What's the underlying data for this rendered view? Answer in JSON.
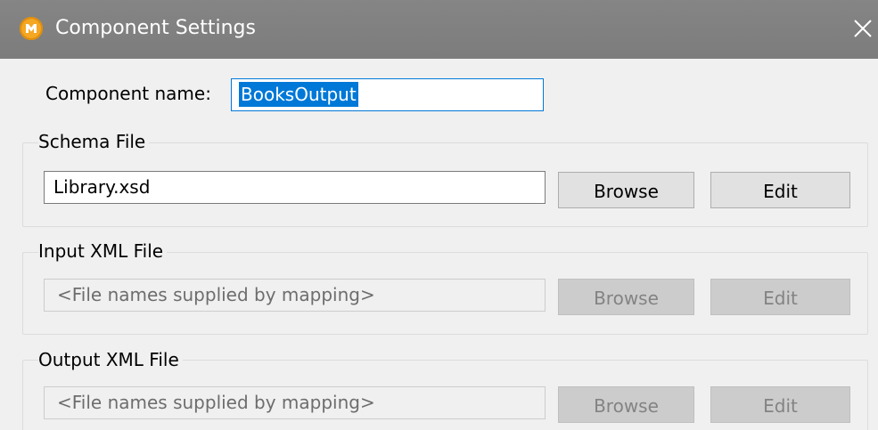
{
  "window": {
    "title": "Component Settings",
    "app_icon": "altova-mapforce-icon",
    "close_icon": "close-icon"
  },
  "component_name": {
    "label": "Component name:",
    "value": "BooksOutput",
    "selected": true
  },
  "schema_file": {
    "group_label": "Schema File",
    "value": "Library.xsd",
    "browse_label": "Browse",
    "edit_label": "Edit",
    "enabled": true
  },
  "input_xml_file": {
    "group_label": "Input XML File",
    "value": "<File names supplied by mapping>",
    "browse_label": "Browse",
    "edit_label": "Edit",
    "enabled": false
  },
  "output_xml_file": {
    "group_label": "Output XML File",
    "value": "<File names supplied by mapping>",
    "browse_label": "Browse",
    "edit_label": "Edit",
    "enabled": false
  },
  "colors": {
    "titlebar": "#808080",
    "accent": "#0078d7",
    "dialog_bg": "#f0f0f0"
  }
}
